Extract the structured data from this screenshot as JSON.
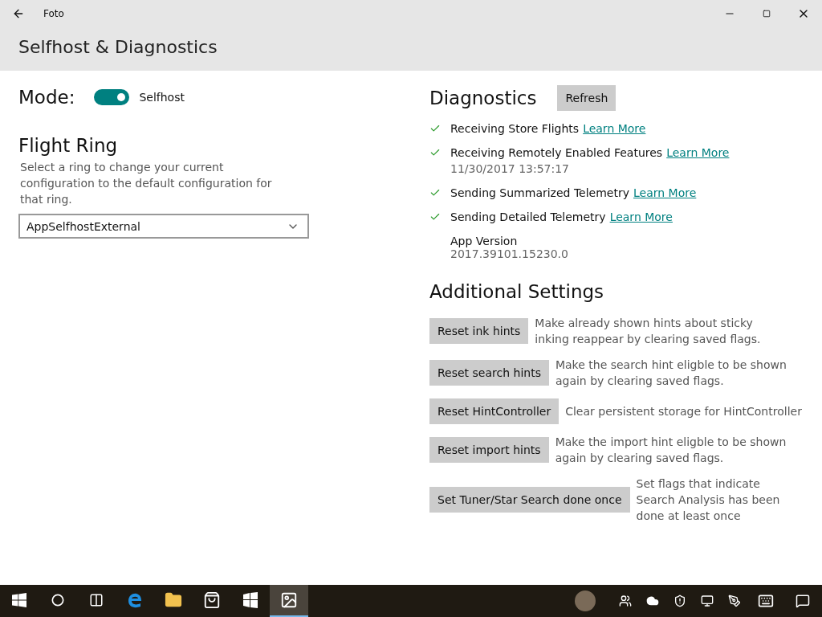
{
  "window": {
    "title": "Foto"
  },
  "page_title": "Selfhost & Diagnostics",
  "mode": {
    "label": "Mode:",
    "on": true,
    "value_label": "Selfhost"
  },
  "flight_ring": {
    "title": "Flight Ring",
    "description": "Select a ring to change your current configuration to the default configuration for that ring.",
    "value": "AppSelfhostExternal"
  },
  "diagnostics": {
    "title": "Diagnostics",
    "refresh_button": "Refresh",
    "items": [
      {
        "label": "Receiving Store Flights",
        "checked": true,
        "link": "Learn More"
      },
      {
        "label": "Receiving Remotely Enabled Features",
        "checked": true,
        "link": "Learn More",
        "timestamp": "11/30/2017 13:57:17"
      },
      {
        "label": "Sending Summarized Telemetry",
        "checked": true,
        "link": "Learn More"
      },
      {
        "label": "Sending Detailed Telemetry",
        "checked": true,
        "link": "Learn More"
      }
    ],
    "app_version": {
      "label": "App Version",
      "value": "2017.39101.15230.0"
    }
  },
  "additional_settings": {
    "title": "Additional Settings",
    "items": [
      {
        "button": "Reset ink hints",
        "description": "Make already shown hints about sticky inking reappear by clearing saved flags."
      },
      {
        "button": "Reset search hints",
        "description": "Make the search hint eligble to be shown again by clearing saved flags."
      },
      {
        "button": "Reset HintController",
        "description": "Clear persistent storage for HintController"
      },
      {
        "button": "Reset import hints",
        "description": "Make the import hint eligble to be shown again by clearing saved flags."
      },
      {
        "button": "Set Tuner/Star Search done once",
        "description": "Set flags that indicate Search Analysis has been done at least once"
      }
    ]
  },
  "taskbar": {
    "apps": [
      {
        "kind": "start",
        "selected": false
      },
      {
        "kind": "search",
        "selected": false
      },
      {
        "kind": "taskview",
        "selected": false
      },
      {
        "kind": "browser",
        "selected": false
      },
      {
        "kind": "folder",
        "selected": false
      },
      {
        "kind": "store",
        "selected": false
      },
      {
        "kind": "tiles",
        "selected": false
      },
      {
        "kind": "photos",
        "selected": true
      }
    ]
  }
}
